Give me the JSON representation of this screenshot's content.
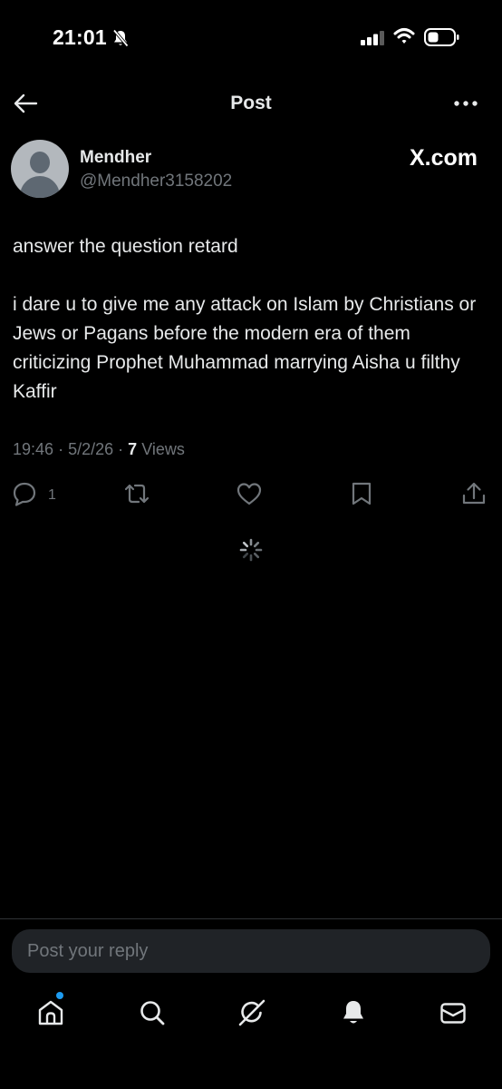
{
  "status_bar": {
    "time": "21:01",
    "icons": [
      "bell-off-icon",
      "signal-icon",
      "wifi-icon",
      "battery-icon"
    ]
  },
  "header": {
    "title": "Post",
    "back_icon": "arrow-left-icon",
    "more_icon": "more-horizontal-icon"
  },
  "post": {
    "author_name": "Mendher",
    "author_handle": "@Mendher3158202",
    "watermark": "X.com",
    "paragraphs": [
      "answer the question retard",
      "i dare u to give me any attack on Islam by Christians or Jews or Pagans before the modern era of them criticizing Prophet Muhammad marrying Aisha u filthy Kaffir"
    ],
    "time": "19:46",
    "date": "5/2/26",
    "views_count": "7",
    "views_label": "Views",
    "separator": "·"
  },
  "actions": {
    "reply_count": "1",
    "icons": [
      "reply-icon",
      "repost-icon",
      "like-icon",
      "bookmark-icon",
      "share-icon"
    ]
  },
  "loading_icon": "spinner-icon",
  "reply_box": {
    "placeholder": "Post your reply"
  },
  "tab_bar": {
    "icons": [
      "home-icon",
      "search-icon",
      "grok-icon",
      "notifications-icon",
      "messages-icon"
    ]
  },
  "colors": {
    "background": "#000000",
    "text_primary": "#e7e9ea",
    "text_secondary": "#71767b",
    "accent": "#1d9bf0",
    "input_background": "#202327"
  }
}
